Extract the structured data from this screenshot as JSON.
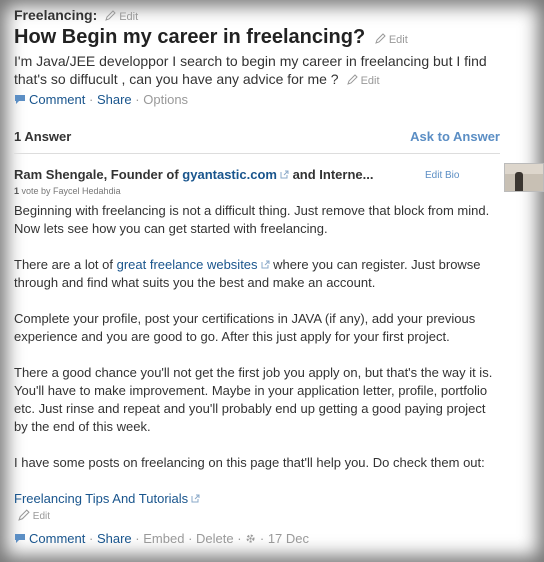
{
  "question": {
    "topic": "Freelancing:",
    "edit_label": "Edit",
    "title": "How Begin my career in freelancing?",
    "text": "I'm Java/JEE developpor I search to begin my career in freelancing but I find that's so diffucult , can you have any advice for me ?",
    "actions": {
      "comment": "Comment",
      "share": "Share",
      "options": "Options",
      "separator": "·"
    }
  },
  "answers_bar": {
    "count": "1 Answer",
    "ask": "Ask to Answer"
  },
  "answer": {
    "author_name": "Ram Shengale, Founder of ",
    "author_link": "gyantastic.com",
    "author_rest": " and Interne...",
    "edit_bio": "Edit Bio",
    "vote_count": "1",
    "vote_text": " vote by Faycel Hedahdia",
    "p1": "Beginning with freelancing is not a difficult thing. Just remove that block from mind. Now lets see how you can get started with freelancing.",
    "p2_before": "There are a lot of ",
    "p2_link": "great freelance websites",
    "p2_after": " where you can register. Just browse through and find what suits you the best and make an account.",
    "p3": "Complete your profile, post your certifications in JAVA (if any), add your previous experience and you are good to go. After this just apply for your first project.",
    "p4": "There a good chance you'll not get the first job you apply on, but that's the way it is. You'll have to make improvement. Maybe in your application letter, profile, portfolio etc. Just rinse and repeat and you'll probably end up getting a good paying project by the end of this week.",
    "p5": "I have some posts on freelancing on this page that'll help you. Do check them out:",
    "tips_link": "Freelancing Tips And Tutorials",
    "edit_label": "Edit",
    "actions": {
      "comment": "Comment",
      "share": "Share",
      "embed": "Embed",
      "delete": "Delete",
      "date": "17 Dec",
      "separator": "·"
    }
  },
  "colors": {
    "link": "#19558d",
    "accent": "#5b8ec4",
    "muted": "#999999"
  },
  "icons": [
    "pencil-icon",
    "external-link-icon",
    "comment-icon",
    "gear-icon"
  ]
}
